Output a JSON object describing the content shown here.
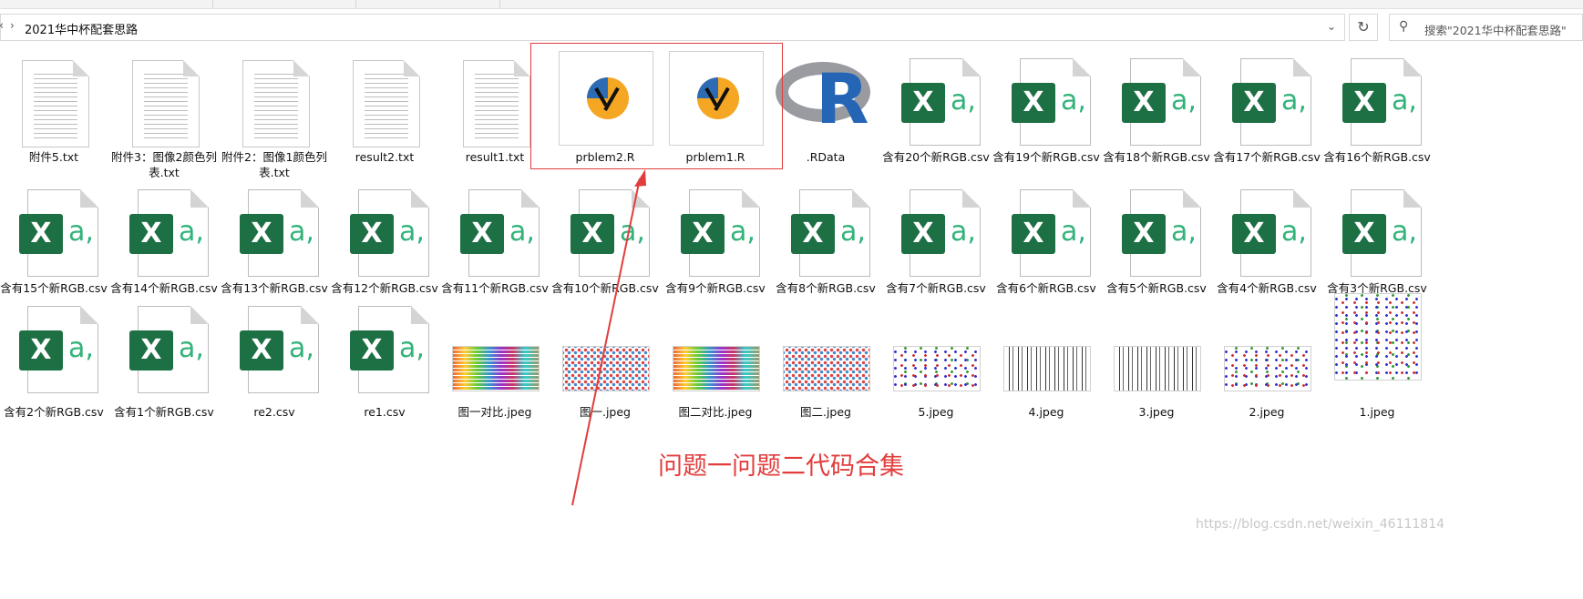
{
  "address": {
    "path": "2021华中杯配套思路",
    "search_placeholder": "搜索\"2021华中杯配套思路\""
  },
  "files": [
    {
      "name": "附件5.txt",
      "icon": "txt-file-icon"
    },
    {
      "name": "附件3：图像2颜色列表.txt",
      "icon": "txt-file-icon"
    },
    {
      "name": "附件2：图像1颜色列表.txt",
      "icon": "txt-file-icon"
    },
    {
      "name": "result2.txt",
      "icon": "txt-file-icon"
    },
    {
      "name": "result1.txt",
      "icon": "txt-file-icon"
    },
    {
      "name": "prblem2.R",
      "icon": "r-script-icon"
    },
    {
      "name": "prblem1.R",
      "icon": "r-script-icon"
    },
    {
      "name": ".RData",
      "icon": "r-logo-icon"
    },
    {
      "name": "含有20个新RGB.csv",
      "icon": "excel-csv-icon"
    },
    {
      "name": "含有19个新RGB.csv",
      "icon": "excel-csv-icon"
    },
    {
      "name": "含有18个新RGB.csv",
      "icon": "excel-csv-icon"
    },
    {
      "name": "含有17个新RGB.csv",
      "icon": "excel-csv-icon"
    },
    {
      "name": "含有16个新RGB.csv",
      "icon": "excel-csv-icon"
    },
    {
      "name": "含有15个新RGB.csv",
      "icon": "excel-csv-icon"
    },
    {
      "name": "含有14个新RGB.csv",
      "icon": "excel-csv-icon"
    },
    {
      "name": "含有13个新RGB.csv",
      "icon": "excel-csv-icon"
    },
    {
      "name": "含有12个新RGB.csv",
      "icon": "excel-csv-icon"
    },
    {
      "name": "含有11个新RGB.csv",
      "icon": "excel-csv-icon"
    },
    {
      "name": "含有10个新RGB.csv",
      "icon": "excel-csv-icon"
    },
    {
      "name": "含有9个新RGB.csv",
      "icon": "excel-csv-icon"
    },
    {
      "name": "含有8个新RGB.csv",
      "icon": "excel-csv-icon"
    },
    {
      "name": "含有7个新RGB.csv",
      "icon": "excel-csv-icon"
    },
    {
      "name": "含有6个新RGB.csv",
      "icon": "excel-csv-icon"
    },
    {
      "name": "含有5个新RGB.csv",
      "icon": "excel-csv-icon"
    },
    {
      "name": "含有4个新RGB.csv",
      "icon": "excel-csv-icon"
    },
    {
      "name": "含有3个新RGB.csv",
      "icon": "excel-csv-icon"
    },
    {
      "name": "含有2个新RGB.csv",
      "icon": "excel-csv-icon"
    },
    {
      "name": "含有1个新RGB.csv",
      "icon": "excel-csv-icon"
    },
    {
      "name": "re2.csv",
      "icon": "excel-csv-icon"
    },
    {
      "name": "re1.csv",
      "icon": "excel-csv-icon"
    },
    {
      "name": "图一对比.jpeg",
      "icon": "palette-image-thumb"
    },
    {
      "name": "图一.jpeg",
      "icon": "dot-grid-image-thumb"
    },
    {
      "name": "图二对比.jpeg",
      "icon": "palette-image-thumb"
    },
    {
      "name": "图二.jpeg",
      "icon": "dot-grid-image-thumb"
    },
    {
      "name": "5.jpeg",
      "icon": "scatter-image-thumb"
    },
    {
      "name": "4.jpeg",
      "icon": "bars-image-thumb"
    },
    {
      "name": "3.jpeg",
      "icon": "bars-image-thumb"
    },
    {
      "name": "2.jpeg",
      "icon": "scatter-image-thumb"
    },
    {
      "name": "1.jpeg",
      "icon": "3d-scatter-image-thumb"
    }
  ],
  "annotation": {
    "text": "问题一问题二代码合集",
    "color": "#e23d3d"
  },
  "watermark": "https://blog.csdn.net/weixin_46111814"
}
